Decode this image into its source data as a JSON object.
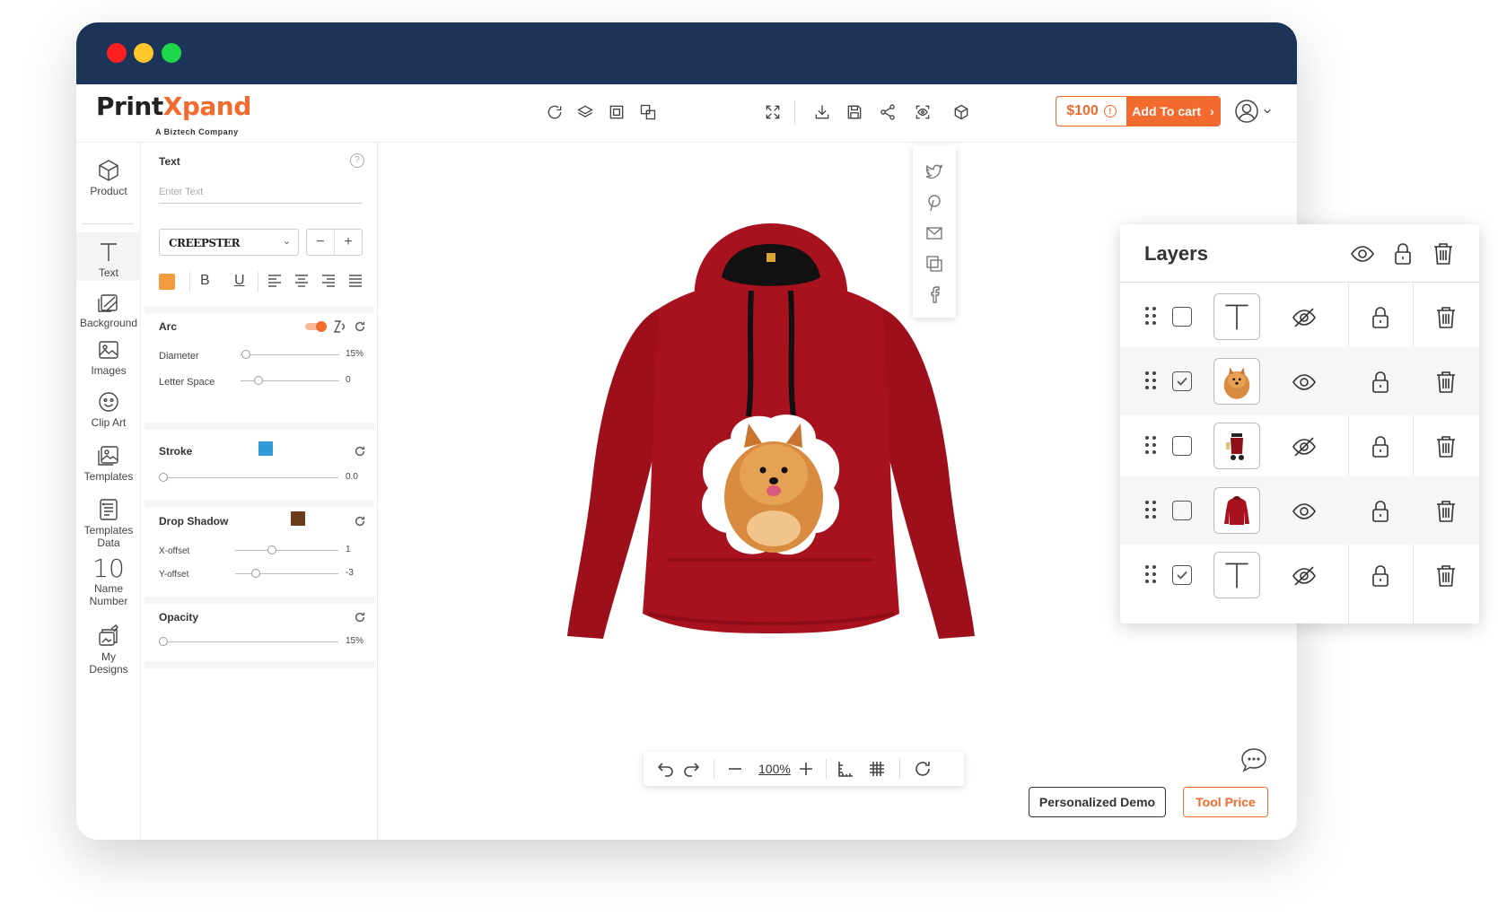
{
  "brand": {
    "name_part1": "Print",
    "name_part2": "Xpand",
    "tagline": "A Biztech Company"
  },
  "colors": {
    "accent": "#f26a2e",
    "titlebar": "#1b3457",
    "hoodie": "#a0111d",
    "stroke_swatch": "#2f9ad9",
    "shadow_swatch": "#6b3a1d",
    "text_color_swatch": "#f39c3d"
  },
  "toolbar": {
    "price": "$100",
    "add_to_cart": "Add To cart",
    "icons": [
      "refresh-icon",
      "layers-icon",
      "copy-icon",
      "arrange-icon",
      "fullscreen-icon",
      "download-icon",
      "save-icon",
      "share-icon",
      "preview-icon",
      "3d-icon"
    ]
  },
  "nav": {
    "items": [
      {
        "label": "Product",
        "icon": "cube-icon"
      },
      {
        "label": "Text",
        "icon": "text-icon"
      },
      {
        "label": "Background",
        "icon": "background-icon"
      },
      {
        "label": "Images",
        "icon": "image-icon"
      },
      {
        "label": "Clip Art",
        "icon": "smiley-icon"
      },
      {
        "label": "Templates",
        "icon": "template-icon"
      },
      {
        "label": "Templates\nData",
        "line1": "Templates",
        "line2": "Data",
        "icon": "template-data-icon"
      },
      {
        "label": "Name Number",
        "glyph": "10",
        "line1": "Name",
        "line2": "Number",
        "icon": "name-number-icon"
      },
      {
        "label": "My Designs",
        "line1": "My",
        "line2": "Designs",
        "icon": "designs-icon"
      }
    ]
  },
  "panel": {
    "text_label": "Text",
    "text_placeholder": "Enter Text",
    "font": "CREEPSTER",
    "bold": "B",
    "underline": "U",
    "arc": {
      "label": "Arc",
      "diameter_label": "Diameter",
      "diameter_value": "15%",
      "diameter_level": 0.05,
      "letter_space_label": "Letter Space",
      "letter_space_value": "0",
      "letter_space_level": 0.15
    },
    "stroke": {
      "label": "Stroke",
      "value": "0.0",
      "level": 0.0
    },
    "drop_shadow": {
      "label": "Drop Shadow",
      "x_label": "X-offset",
      "x_value": "1",
      "x_level": 0.35,
      "y_label": "Y-offset",
      "y_value": "-3",
      "y_level": 0.18
    },
    "opacity": {
      "label": "Opacity",
      "value": "15%",
      "level": 0.0
    }
  },
  "share_menu": [
    "twitter-icon",
    "pinterest-icon",
    "mail-icon",
    "copy-link-icon",
    "facebook-icon"
  ],
  "zoom": {
    "value": "100%"
  },
  "buttons": {
    "demo": "Personalized Demo",
    "tool_price": "Tool Price"
  },
  "layers": {
    "title": "Layers",
    "rows": [
      {
        "checked": false,
        "thumb": "text",
        "visible": false
      },
      {
        "checked": true,
        "thumb": "dog",
        "visible": true
      },
      {
        "checked": false,
        "thumb": "scooter",
        "visible": false
      },
      {
        "checked": false,
        "thumb": "hoodie",
        "visible": true
      },
      {
        "checked": true,
        "thumb": "text",
        "visible": false
      }
    ]
  }
}
